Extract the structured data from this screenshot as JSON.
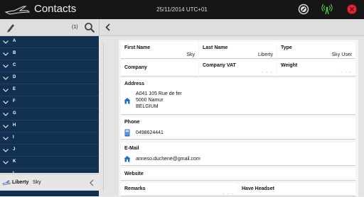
{
  "app": {
    "title": "Contacts",
    "datetime": "25/11/2014  UTC+01"
  },
  "status_icons": [
    "clock-icon",
    "signal-icon",
    "alert-icon"
  ],
  "list": {
    "count": "(1)",
    "letters": [
      "A",
      "B",
      "C",
      "D",
      "E",
      "F",
      "G",
      "H",
      "I",
      "J",
      "K",
      "L"
    ]
  },
  "selected_contact": {
    "last_name": "Liberty",
    "first_name": "Sky"
  },
  "details": {
    "first_name_label": "First Name",
    "first_name": "Sky",
    "last_name_label": "Last Name",
    "last_name": "Liberty",
    "type_label": "Type",
    "type": "Sky User",
    "company_label": "Company",
    "company": "",
    "company_vat_label": "Company VAT",
    "company_vat": "- - -",
    "weight_label": "Weight",
    "weight": "- - -",
    "address_label": "Address",
    "address_line1": "A041 105 Rue de fer",
    "address_line2": "5000 Namur",
    "address_line3": "BELGIUM",
    "phone_label": "Phone",
    "phone": "0498624441",
    "email_label": "E-Mail",
    "email": "anneso.duchene@gmail.com",
    "website_label": "Website",
    "remarks_label": "Remarks",
    "remarks": "- - -",
    "headset_label": "Have Headset"
  },
  "colors": {
    "topbar": "#161616",
    "sidebar": "#12304f",
    "accent": "#1f6fd1",
    "signal": "#5be04a",
    "alert": "#e0283a"
  }
}
